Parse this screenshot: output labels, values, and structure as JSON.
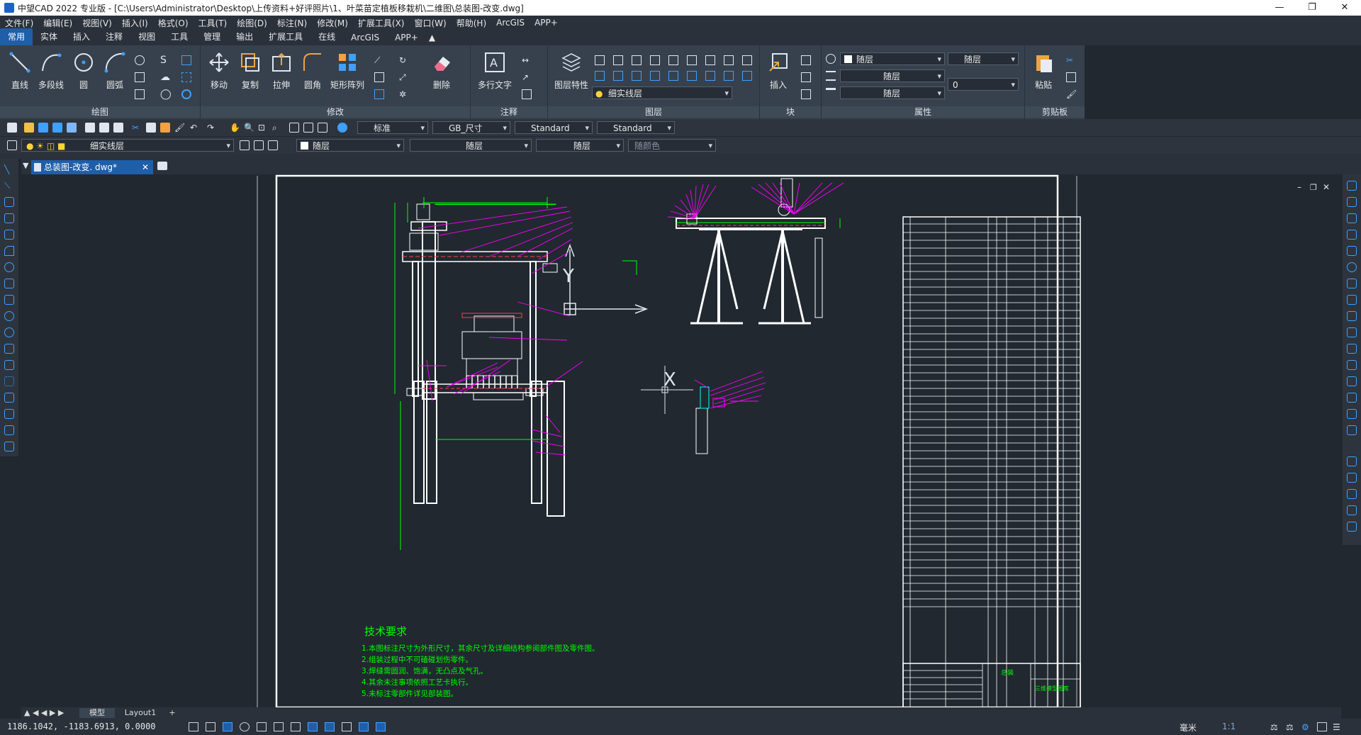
{
  "window": {
    "title": "中望CAD 2022 专业版 - [C:\\Users\\Administrator\\Desktop\\上传资料+好评照片\\1、叶菜苗定植板移栽机\\二维图\\总装图-改变.dwg]",
    "controls": [
      "—",
      "❐",
      "✕"
    ]
  },
  "menubar": [
    "文件(F)",
    "编辑(E)",
    "视图(V)",
    "插入(I)",
    "格式(O)",
    "工具(T)",
    "绘图(D)",
    "标注(N)",
    "修改(M)",
    "扩展工具(X)",
    "窗口(W)",
    "帮助(H)",
    "ArcGIS",
    "APP+"
  ],
  "ribbon_tabs": [
    "常用",
    "实体",
    "插入",
    "注释",
    "视图",
    "工具",
    "管理",
    "输出",
    "扩展工具",
    "在线",
    "ArcGIS",
    "APP+"
  ],
  "ribbon": {
    "draw": {
      "title": "绘图",
      "buttons": [
        "直线",
        "多段线",
        "圆",
        "圆弧"
      ]
    },
    "modify": {
      "title": "修改",
      "buttons": [
        "移动",
        "复制",
        "拉伸",
        "圆角",
        "矩形阵列",
        "删除"
      ]
    },
    "annotate": {
      "title": "注释",
      "buttons": [
        "多行文字"
      ]
    },
    "layer": {
      "title": "图层",
      "buttons": [
        "图层特性"
      ],
      "current_layer": "细实线层"
    },
    "block": {
      "title": "块",
      "buttons": [
        "插入"
      ]
    },
    "properties": {
      "title": "属性",
      "color": "随层",
      "linetype": "随层",
      "lineweight": "随层",
      "plotstyle": "随层",
      "transparency": "0"
    },
    "clipboard": {
      "title": "剪贴板",
      "buttons": [
        "粘贴"
      ]
    }
  },
  "toolbar1": {
    "text_style": "标准",
    "dim_style": "GB_尺寸",
    "table_style": "Standard",
    "multileader_style": "Standard"
  },
  "toolbar2": {
    "layer": "细实线层",
    "color": "随层",
    "linetype": "随层",
    "lineweight": "随层",
    "plot_color": "随颜色"
  },
  "document": {
    "tab_label": "总装图-改变. dwg*"
  },
  "drawing": {
    "tech_title": "技术要求",
    "tech_notes": [
      "1.本图标注尺寸为外形尺寸，其余尺寸及详细结构参阅部件图及零件图。",
      "2.组装过程中不可磕碰划伤零件。",
      "3.焊缝需圆润、饱满，无凸点及气孔。",
      "4.其余未注事项依照工艺卡执行。",
      "5.未标注零部件详见部装图。"
    ],
    "axis_y": "Y",
    "axis_x": "X",
    "title_block": {
      "name": "总装",
      "org": "三维模型图库"
    }
  },
  "layout_tabs": [
    "模型",
    "Layout1",
    "+"
  ],
  "status": {
    "coords": "1186.1042, -1183.6913, 0.0000",
    "units": "毫米",
    "scale": "1:1"
  },
  "colors": {
    "accent": "#1f5ea8",
    "background": "#212830",
    "cad_white": "#ffffff",
    "cad_green": "#00ff00",
    "cad_magenta": "#ff00ff"
  }
}
